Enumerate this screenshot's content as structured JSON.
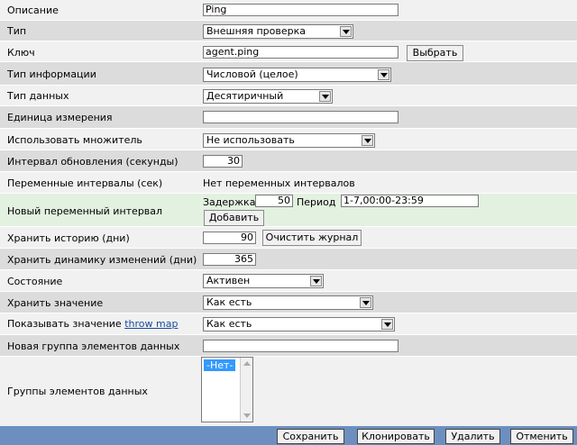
{
  "rows": {
    "description": {
      "label": "Описание",
      "value": "Ping"
    },
    "type": {
      "label": "Тип",
      "value": "Внешняя проверка"
    },
    "key": {
      "label": "Ключ",
      "value": "agent.ping",
      "button": "Выбрать"
    },
    "info_type": {
      "label": "Тип информации",
      "value": "Числовой (целое)"
    },
    "data_type": {
      "label": "Тип данных",
      "value": "Десятиричный"
    },
    "units": {
      "label": "Единица измерения",
      "value": ""
    },
    "multiplier": {
      "label": "Использовать множитель",
      "value": "Не использовать"
    },
    "update_interval": {
      "label": "Интервал обновления (секунды)",
      "value": "30"
    },
    "flex_intervals": {
      "label": "Переменные интервалы (сек)",
      "value": "Нет переменных интервалов"
    },
    "new_flex": {
      "label": "Новый переменный интервал",
      "delay_label": "Задержка",
      "delay_value": "50",
      "period_label": "Период",
      "period_value": "1-7,00:00-23:59",
      "add_button": "Добавить"
    },
    "history": {
      "label": "Хранить историю (дни)",
      "value": "90",
      "button": "Очистить журнал"
    },
    "trends": {
      "label": "Хранить динамику изменений (дни)",
      "value": "365"
    },
    "status": {
      "label": "Состояние",
      "value": "Активен"
    },
    "store_value": {
      "label": "Хранить значение",
      "value": "Как есть"
    },
    "show_value": {
      "label": "Показывать значение",
      "link": "throw map",
      "value": "Как есть"
    },
    "new_app": {
      "label": "Новая группа элементов данных",
      "value": ""
    },
    "apps": {
      "label": "Группы элементов данных",
      "option": "-Нет-"
    }
  },
  "footer": {
    "save": "Сохранить",
    "clone": "Клонировать",
    "delete": "Удалить",
    "cancel": "Отменить"
  },
  "colors": {
    "footer_bg": "#6d8fc0",
    "selected_option": "#3399ff",
    "link": "#1a4a9c"
  }
}
